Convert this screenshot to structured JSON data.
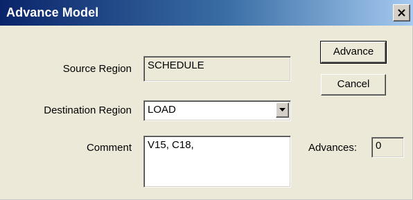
{
  "window": {
    "title": "Advance Model",
    "close_glyph": "close-icon"
  },
  "form": {
    "source_region_label": "Source Region",
    "source_region_value": "SCHEDULE",
    "destination_region_label": "Destination Region",
    "destination_region_value": "LOAD",
    "comment_label": "Comment",
    "comment_value": "V15, C18,",
    "advances_label": "Advances:",
    "advances_value": "0"
  },
  "buttons": {
    "advance_label": "Advance",
    "cancel_label": "Cancel"
  },
  "colors": {
    "title_bar_start": "#0a246a",
    "title_bar_end": "#a6caf0",
    "dialog_face": "#ece9d8"
  }
}
